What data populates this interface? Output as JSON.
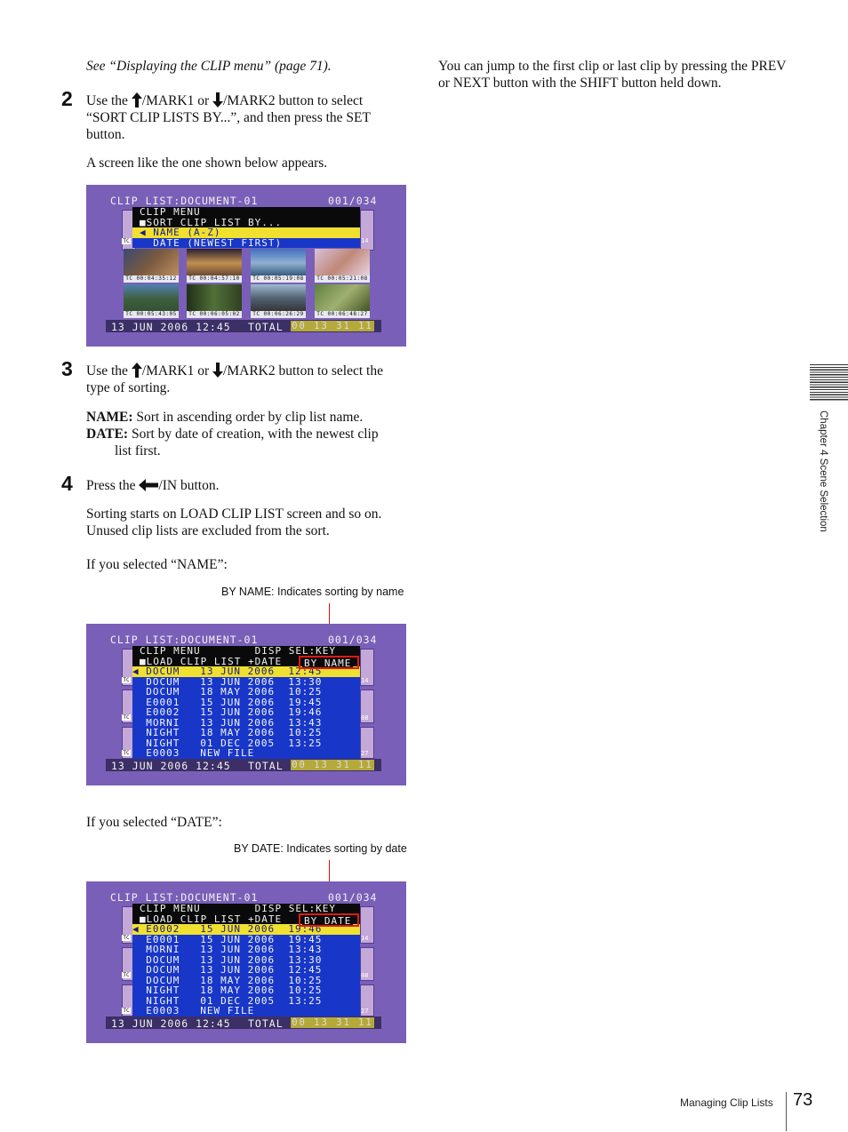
{
  "intro_ref": "See “Displaying the CLIP menu” (page 71).",
  "right_col": "You can jump to the first clip or last clip by pressing the PREV or NEXT button with the SHIFT button held down.",
  "step2": {
    "num": "2",
    "pre": "Use the ",
    "mid": "/MARK1 or ",
    "post": "/MARK2 button to select",
    "line2": "“SORT CLIP LISTS BY...”, and then press the SET",
    "line3": "button.",
    "note": "A screen like the one shown below appears."
  },
  "step3": {
    "num": "3",
    "pre": "Use the ",
    "mid": "/MARK1 or ",
    "post": "/MARK2 button to select the",
    "line2": "type of sorting.",
    "name_term": "NAME:",
    "name_desc": " Sort in ascending order by clip list name.",
    "date_term": "DATE:",
    "date_desc": " Sort by date of creation, with the newest clip",
    "date_desc2": "list first."
  },
  "step4": {
    "num": "4",
    "pre": "Press the ",
    "post": "/IN button.",
    "para1a": "Sorting starts on LOAD CLIP LIST screen and so on.",
    "para1b": "Unused clip lists are excluded from the sort.",
    "if_name": "If you selected “NAME”:",
    "if_date": "If you selected “DATE”:"
  },
  "callouts": {
    "by_name": "BY NAME: Indicates sorting by name",
    "by_date": "BY DATE: Indicates sorting by date"
  },
  "screen_common": {
    "title": "CLIP LIST:DOCUMENT-01",
    "counter": "001/034",
    "date": "13 JUN 2006 12:45",
    "total_label": "TOTAL",
    "total_value": "00 13 31 11",
    "tc": "TC"
  },
  "screen1": {
    "menu_title": "CLIP MENU",
    "menu_sub": "■SORT CLIP LIST BY...",
    "opt_name": "◀ NAME (A-Z)",
    "opt_date": "  DATE (NEWEST FIRST)",
    "side_num": "14",
    "timecodes": [
      "TC 00:04:35:12",
      "TC 00:04:57:10",
      "TC 00:05:19:08",
      "TC 00:05:21:08",
      "TC 00:05:43:05",
      "TC 00:06:05:02",
      "TC 00:06:26:29",
      "TC 00:06:48:27"
    ]
  },
  "screen2": {
    "header1": "CLIP MENU        DISP SEL:KEY",
    "header2": "■LOAD CLIP LIST +DATE",
    "badge": "BY NAME",
    "side_nums": [
      "14",
      "08",
      "27"
    ],
    "rows": [
      "◀ DOCUM   13 JUN 2006  12:45",
      "  DOCUM   13 JUN 2006  13:30",
      "  DOCUM   18 MAY 2006  10:25",
      "  E0001   15 JUN 2006  19:45",
      "  E0002   15 JUN 2006  19:46",
      "  MORNI   13 JUN 2006  13:43",
      "  NIGHT   18 MAY 2006  10:25",
      "  NIGHT   01 DEC 2005  13:25",
      "  E0003   NEW FILE"
    ]
  },
  "screen3": {
    "header1": "CLIP MENU        DISP SEL:KEY",
    "header2": "■LOAD CLIP LIST +DATE",
    "badge": "BY DATE",
    "side_nums": [
      "14",
      "08",
      "27"
    ],
    "rows": [
      "◀ E0002   15 JUN 2006  19:46",
      "  E0001   15 JUN 2006  19:45",
      "  MORNI   13 JUN 2006  13:43",
      "  DOCUM   13 JUN 2006  13:30",
      "  DOCUM   13 JUN 2006  12:45",
      "  DOCUM   18 MAY 2006  10:25",
      "  NIGHT   18 MAY 2006  10:25",
      "  NIGHT   01 DEC 2005  13:25",
      "  E0003   NEW FILE"
    ]
  },
  "sidebar": {
    "chapter": "Chapter 4  Scene Selection"
  },
  "footer": {
    "section": "Managing Clip Lists",
    "page": "73"
  },
  "colors": {
    "screen_bg": "#7a5fb8",
    "highlight": "#f0e030",
    "list_blue": "#1837c8",
    "callout_red": "#e01818"
  }
}
